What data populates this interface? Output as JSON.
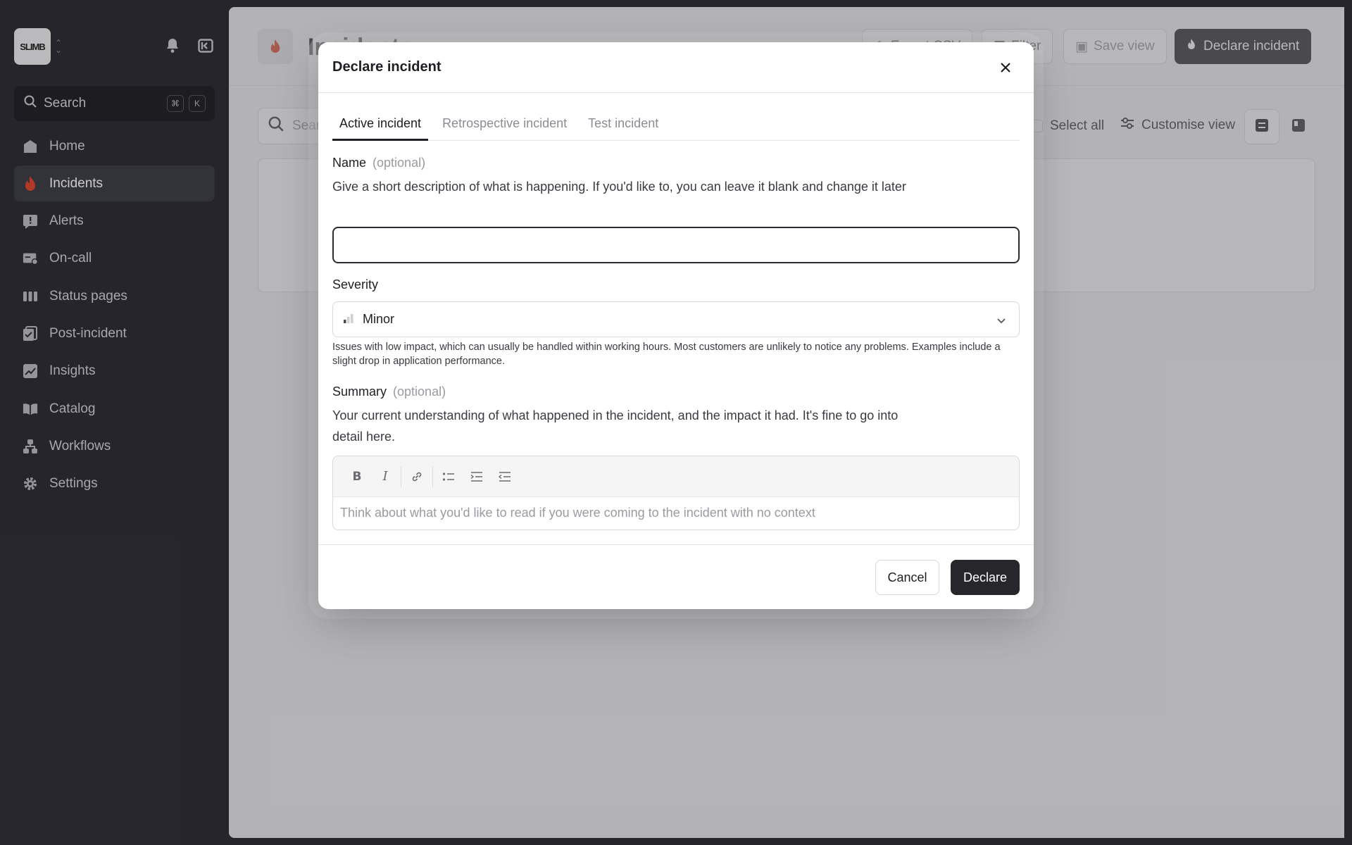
{
  "sidebar": {
    "logo_text": "SLIMB",
    "search": {
      "label": "Search",
      "shortcut_keys": [
        "⌘",
        "K"
      ]
    },
    "items": [
      {
        "label": "Home",
        "icon": "home-icon"
      },
      {
        "label": "Incidents",
        "icon": "flame-icon",
        "active": true
      },
      {
        "label": "Alerts",
        "icon": "alert-icon"
      },
      {
        "label": "On-call",
        "icon": "on-call-icon"
      },
      {
        "label": "Status pages",
        "icon": "status-pages-icon"
      },
      {
        "label": "Post-incident",
        "icon": "post-incident-icon"
      },
      {
        "label": "Insights",
        "icon": "insights-icon"
      },
      {
        "label": "Catalog",
        "icon": "catalog-icon"
      },
      {
        "label": "Workflows",
        "icon": "workflows-icon"
      },
      {
        "label": "Settings",
        "icon": "gear-icon"
      }
    ]
  },
  "page": {
    "title": "Incidents",
    "export_label": "Export CSV",
    "filter_label": "Filter",
    "save_view_label": "Save view",
    "declare_label": "Declare incident",
    "search_placeholder": "Search",
    "select_all_label": "Select all",
    "customise_label": "Customise view"
  },
  "modal": {
    "title": "Declare incident",
    "tabs": [
      "Active incident",
      "Retrospective incident",
      "Test incident"
    ],
    "name": {
      "label": "Name",
      "optional": "(optional)",
      "help": "Give a short description of what is happening. If you'd like to, you can leave it blank and change it later",
      "value": ""
    },
    "severity": {
      "label": "Severity",
      "value": "Minor",
      "help": "Issues with low impact, which can usually be handled within working hours. Most customers are unlikely to notice any problems. Examples include a slight drop in application performance."
    },
    "summary": {
      "label": "Summary",
      "optional": "(optional)",
      "help": "Your current understanding of what happened in the incident, and the impact it had. It's fine to go into detail here.",
      "placeholder": "Think about what you'd like to read if you were coming to the incident with no context"
    },
    "cancel_label": "Cancel",
    "declare_label": "Declare"
  },
  "colors": {
    "brand_flame": "#e0452c",
    "dark": "#26262b"
  }
}
